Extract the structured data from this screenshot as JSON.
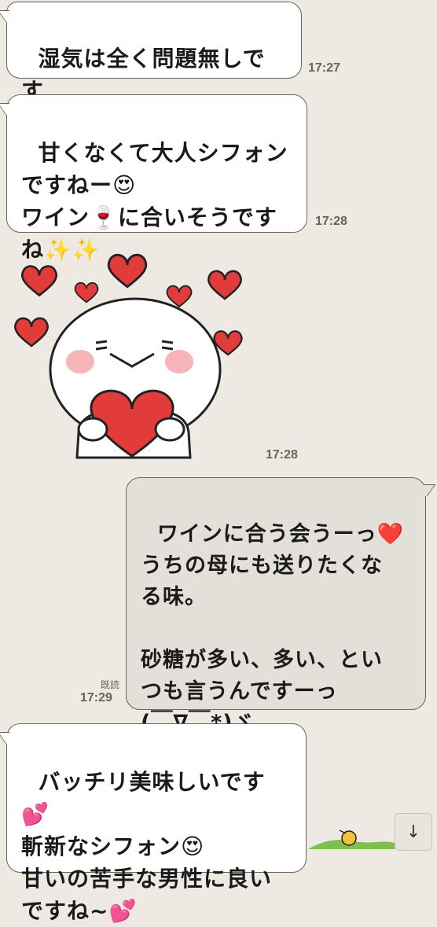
{
  "messages": [
    {
      "type": "incoming",
      "text": "湿気は全く問題無しです\n😆🎵🎵",
      "time": "17:27"
    },
    {
      "type": "incoming",
      "text": "甘くなくて大人シフォン\nですねー😍\nワイン🍷に合いそうです\nね✨✨",
      "time": "17:28"
    },
    {
      "type": "sticker",
      "name": "heart-hug-sticker",
      "time": "17:28"
    },
    {
      "type": "outgoing",
      "text": "ワインに合う会うーっ❤️\nうちの母にも送りたくな\nる味。\n\n砂糖が多い、多い、とい\nつも言うんですーっ\n(￣∇￣*)ゞ",
      "time": "17:29",
      "read_label": "既読"
    },
    {
      "type": "incoming",
      "text": "バッチリ美味しいです💕\n斬新なシフォン😍\n甘いの苦手な男性に良い\nですね~💕",
      "time": ""
    }
  ],
  "scroll_button": {
    "icon": "arrow-down-icon",
    "glyph": "↓"
  }
}
